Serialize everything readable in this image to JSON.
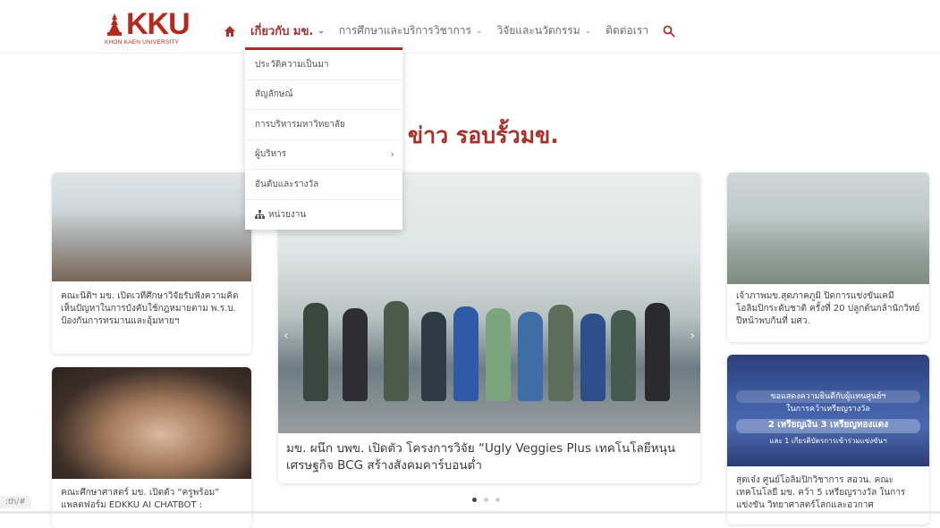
{
  "brand": {
    "logo_text": "KKU",
    "logo_sub": "KHON KAEN UNIVERSITY",
    "accent": "#a8302a"
  },
  "nav": {
    "home_icon": "home-icon",
    "items": [
      {
        "label": "เกี่ยวกับ มข.",
        "active": true,
        "chevron": "⌄"
      },
      {
        "label": "การศึกษาและบริการวิชาการ",
        "chevron": "⌄"
      },
      {
        "label": "วิจัยและนวัตกรรม",
        "chevron": "⌄"
      },
      {
        "label": "ติดต่อเรา"
      }
    ],
    "search_icon": "search-icon"
  },
  "dropdown": {
    "items": [
      {
        "label": "ประวัติความเป็นมา"
      },
      {
        "label": "สัญลักษณ์"
      },
      {
        "label": "การบริหารมหาวิทยาลัย"
      },
      {
        "label": "ผู้บริหาร",
        "arrow": "›"
      },
      {
        "label": "อันดับและรางวัล"
      },
      {
        "label": "หน่วยงาน",
        "icon": "sitemap-icon"
      }
    ]
  },
  "section": {
    "title_accent": "ข่าว รอบรั้วมข.",
    "title_dark": ""
  },
  "news": [
    {
      "caption": "คณะนิติฯ มข. เปิดเวทีศึกษาวิจัยรับฟังความคิดเห็นปัญหาในการบังคับใช้กฎหมายตาม พ.ร.บ. ป้องกันการทรมานและอุ้มหายฯ"
    },
    {
      "caption": "คณะศึกษาศาสตร์ มข. เปิดตัว “ครูพร้อม” แพลตฟอร์ม EDKKU AI CHATBOT :"
    },
    {
      "caption": "มข. ผนึก บพข. เปิดตัว โครงการวิจัย “Ugly Veggies Plus เทคโนโลยีหนุนเศรษฐกิจ BCG สร้างสังคมคาร์บอนต่ำ"
    },
    {
      "caption": "เจ้าภาพมข.สุดภาคภูมิ ปิดการแข่งขันเคมีโอลิมปิกระดับชาติ ครั้งที่ 20 ปลูกต้นกล้านักวิทย์ ปีหน้าพบกันที่ มศว."
    },
    {
      "caption": "สุดเจ๋ง ศูนย์โอลิมปิกวิชาการ สอวน. คณะเทคโนโลยี มข. คว้า 5 เหรียญรางวัล ในการแข่งขัน วิทยาศาสตร์โลกและอวกาศ"
    }
  ],
  "slide_banner": {
    "line1": "ขอแสดงความยินดีกับผู้แทนศูนย์ฯ",
    "line2": "ในการคว้าเหรียญรางวัล",
    "line3": "2 เหรียญเงิน 3 เหรียญทองแดง",
    "line4": "และ 1 เกียรติบัตรการเข้าร่วมแข่งขันฯ"
  },
  "slider": {
    "count": 3,
    "active_index": 0
  },
  "status": {
    "url": ":th/#"
  }
}
